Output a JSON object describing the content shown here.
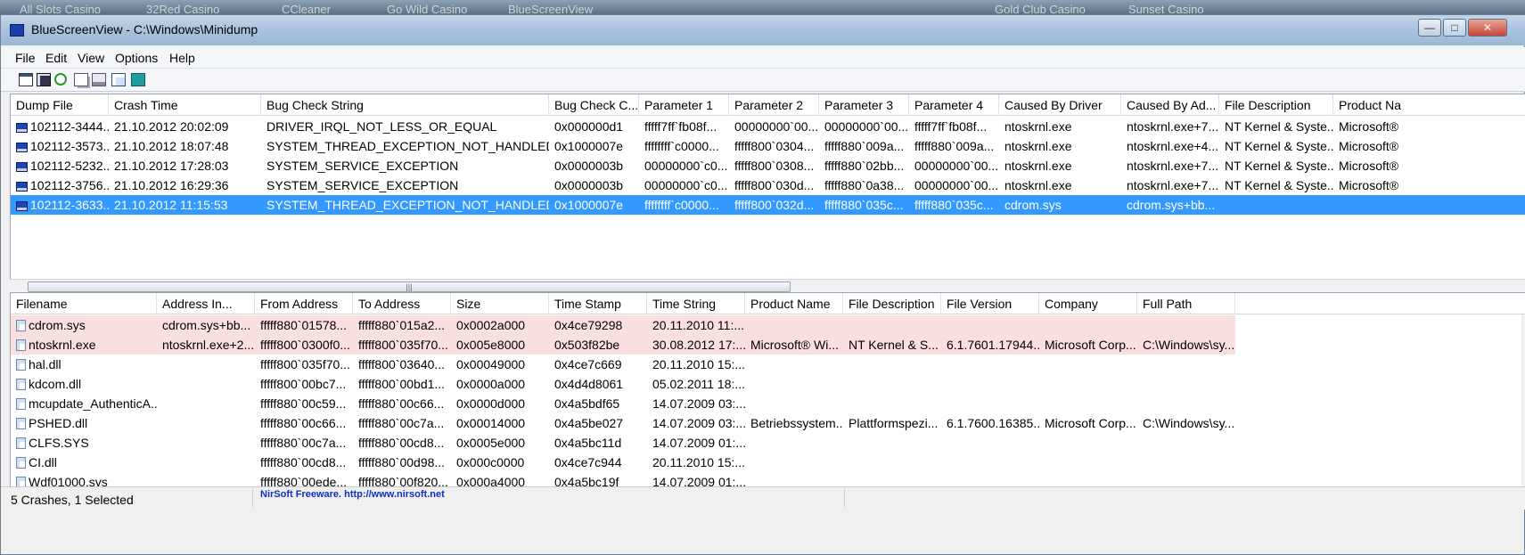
{
  "desktop_labels": [
    "All Slots Casino",
    "32Red Casino",
    "CCleaner",
    "Go Wild Casino",
    "BlueScreenView",
    "Gold Club Casino",
    "Sunset Casino"
  ],
  "window": {
    "title": "BlueScreenView  -  C:\\Windows\\Minidump"
  },
  "menu": [
    "File",
    "Edit",
    "View",
    "Options",
    "Help"
  ],
  "toolbar": [
    "save-icon",
    "floppy-icon",
    "refresh-icon",
    "copy-icon",
    "properties-icon",
    "find-icon",
    "exit-icon"
  ],
  "crash_list": {
    "columns": [
      "Dump File",
      "Crash Time",
      "Bug Check String",
      "Bug Check C...",
      "Parameter 1",
      "Parameter 2",
      "Parameter 3",
      "Parameter 4",
      "Caused By Driver",
      "Caused By Ad...",
      "File Description",
      "Product Na"
    ],
    "rows": [
      [
        "102112-3444...",
        "21.10.2012 20:02:09",
        "DRIVER_IRQL_NOT_LESS_OR_EQUAL",
        "0x000000d1",
        "fffff7ff`fb08f...",
        "00000000`00...",
        "00000000`00...",
        "fffff7ff`fb08f...",
        "ntoskrnl.exe",
        "ntoskrnl.exe+7...",
        "NT Kernel & Syste...",
        "Microsoft®"
      ],
      [
        "102112-3573...",
        "21.10.2012 18:07:48",
        "SYSTEM_THREAD_EXCEPTION_NOT_HANDLED",
        "0x1000007e",
        "ffffffff`c0000...",
        "fffff800`0304...",
        "fffff880`009a...",
        "fffff880`009a...",
        "ntoskrnl.exe",
        "ntoskrnl.exe+4...",
        "NT Kernel & Syste...",
        "Microsoft®"
      ],
      [
        "102112-5232...",
        "21.10.2012 17:28:03",
        "SYSTEM_SERVICE_EXCEPTION",
        "0x0000003b",
        "00000000`c0...",
        "fffff800`0308...",
        "fffff880`02bb...",
        "00000000`00...",
        "ntoskrnl.exe",
        "ntoskrnl.exe+7...",
        "NT Kernel & Syste...",
        "Microsoft®"
      ],
      [
        "102112-3756...",
        "21.10.2012 16:29:36",
        "SYSTEM_SERVICE_EXCEPTION",
        "0x0000003b",
        "00000000`c0...",
        "fffff800`030d...",
        "fffff880`0a38...",
        "00000000`00...",
        "ntoskrnl.exe",
        "ntoskrnl.exe+7...",
        "NT Kernel & Syste...",
        "Microsoft®"
      ],
      [
        "102112-3633...",
        "21.10.2012 11:15:53",
        "SYSTEM_THREAD_EXCEPTION_NOT_HANDLED",
        "0x1000007e",
        "ffffffff`c0000...",
        "fffff800`032d...",
        "fffff880`035c...",
        "fffff880`035c...",
        "cdrom.sys",
        "cdrom.sys+bb...",
        "",
        ""
      ]
    ],
    "selected_index": 4
  },
  "driver_list": {
    "columns": [
      "Filename",
      "Address In...",
      "From Address",
      "To Address",
      "Size",
      "Time Stamp",
      "Time String",
      "Product Name",
      "File Description",
      "File Version",
      "Company",
      "Full Path"
    ],
    "rows": [
      [
        "cdrom.sys",
        "cdrom.sys+bb...",
        "fffff880`01578...",
        "fffff880`015a2...",
        "0x0002a000",
        "0x4ce79298",
        "20.11.2010 11:...",
        "",
        "",
        "",
        "",
        ""
      ],
      [
        "ntoskrnl.exe",
        "ntoskrnl.exe+2...",
        "fffff800`0300f0...",
        "fffff800`035f70...",
        "0x005e8000",
        "0x503f82be",
        "30.08.2012 17:...",
        "Microsoft® Wi...",
        "NT Kernel & S...",
        "6.1.7601.17944...",
        "Microsoft Corp...",
        "C:\\Windows\\sy..."
      ],
      [
        "hal.dll",
        "",
        "fffff800`035f70...",
        "fffff800`03640...",
        "0x00049000",
        "0x4ce7c669",
        "20.11.2010 15:...",
        "",
        "",
        "",
        "",
        ""
      ],
      [
        "kdcom.dll",
        "",
        "fffff800`00bc7...",
        "fffff800`00bd1...",
        "0x0000a000",
        "0x4d4d8061",
        "05.02.2011 18:...",
        "",
        "",
        "",
        "",
        ""
      ],
      [
        "mcupdate_AuthenticA...",
        "",
        "fffff880`00c59...",
        "fffff880`00c66...",
        "0x0000d000",
        "0x4a5bdf65",
        "14.07.2009 03:...",
        "",
        "",
        "",
        "",
        ""
      ],
      [
        "PSHED.dll",
        "",
        "fffff880`00c66...",
        "fffff880`00c7a...",
        "0x00014000",
        "0x4a5be027",
        "14.07.2009 03:...",
        "Betriebssystem...",
        "Plattformspezi...",
        "6.1.7600.16385...",
        "Microsoft Corp...",
        "C:\\Windows\\sy..."
      ],
      [
        "CLFS.SYS",
        "",
        "fffff880`00c7a...",
        "fffff880`00cd8...",
        "0x0005e000",
        "0x4a5bc11d",
        "14.07.2009 01:...",
        "",
        "",
        "",
        "",
        ""
      ],
      [
        "CI.dll",
        "",
        "fffff880`00cd8...",
        "fffff880`00d98...",
        "0x000c0000",
        "0x4ce7c944",
        "20.11.2010 15:...",
        "",
        "",
        "",
        "",
        ""
      ],
      [
        "Wdf01000.sys",
        "",
        "fffff880`00ede...",
        "fffff880`00f820...",
        "0x000a4000",
        "0x4a5bc19f",
        "14.07.2009 01:...",
        "",
        "",
        "",
        "",
        ""
      ]
    ],
    "highlighted_rows": [
      0,
      1
    ]
  },
  "status": {
    "count": "5 Crashes, 1 Selected",
    "nirsoft": "NirSoft Freeware.  http://www.nirsoft.net"
  },
  "colors": {
    "selection": "#3399ff",
    "highlight": "#fadfe0",
    "link": "#1030c0"
  }
}
